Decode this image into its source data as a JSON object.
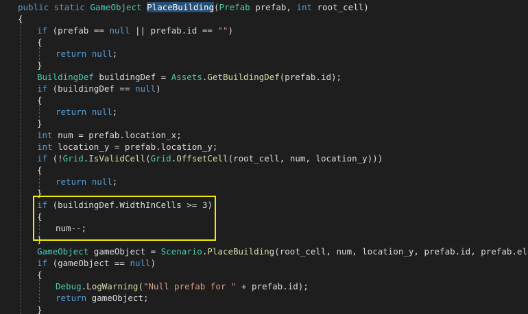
{
  "editor": {
    "theme_colors": {
      "background": "#1e1e1e",
      "keyword": "#569cd6",
      "type": "#4ec9b0",
      "method": "#dcdcaa",
      "string": "#d69d85",
      "plain": "#dcdcdc",
      "highlight_box": "#f2ea00"
    },
    "lines": [
      {
        "indent": 1,
        "tokens": [
          {
            "t": "public static ",
            "c": "kw"
          },
          {
            "t": "GameObject",
            "c": "ty"
          },
          {
            "t": " ",
            "c": "pl"
          },
          {
            "t": "PlaceBuilding",
            "c": "hl"
          },
          {
            "t": "(",
            "c": "pl"
          },
          {
            "t": "Prefab",
            "c": "ty"
          },
          {
            "t": " prefab, ",
            "c": "pl"
          },
          {
            "t": "int",
            "c": "kw"
          },
          {
            "t": " root_cell)",
            "c": "pl"
          }
        ]
      },
      {
        "indent": 1,
        "tokens": [
          {
            "t": "{",
            "c": "pl"
          }
        ]
      },
      {
        "indent": 2,
        "tokens": [
          {
            "t": "if",
            "c": "kw"
          },
          {
            "t": " (prefab == ",
            "c": "pl"
          },
          {
            "t": "null",
            "c": "kw"
          },
          {
            "t": " || prefab.id == ",
            "c": "pl"
          },
          {
            "t": "\"\"",
            "c": "st"
          },
          {
            "t": ")",
            "c": "pl"
          }
        ]
      },
      {
        "indent": 2,
        "tokens": [
          {
            "t": "{",
            "c": "pl"
          }
        ]
      },
      {
        "indent": 3,
        "tokens": [
          {
            "t": "return",
            "c": "kw"
          },
          {
            "t": " ",
            "c": "pl"
          },
          {
            "t": "null",
            "c": "kw"
          },
          {
            "t": ";",
            "c": "pl"
          }
        ]
      },
      {
        "indent": 2,
        "tokens": [
          {
            "t": "}",
            "c": "pl"
          }
        ]
      },
      {
        "indent": 2,
        "tokens": [
          {
            "t": "BuildingDef",
            "c": "ty"
          },
          {
            "t": " buildingDef = ",
            "c": "pl"
          },
          {
            "t": "Assets",
            "c": "ty"
          },
          {
            "t": ".",
            "c": "pl"
          },
          {
            "t": "GetBuildingDef",
            "c": "mt"
          },
          {
            "t": "(prefab.id);",
            "c": "pl"
          }
        ]
      },
      {
        "indent": 2,
        "tokens": [
          {
            "t": "if",
            "c": "kw"
          },
          {
            "t": " (buildingDef == ",
            "c": "pl"
          },
          {
            "t": "null",
            "c": "kw"
          },
          {
            "t": ")",
            "c": "pl"
          }
        ]
      },
      {
        "indent": 2,
        "tokens": [
          {
            "t": "{",
            "c": "pl"
          }
        ]
      },
      {
        "indent": 3,
        "tokens": [
          {
            "t": "return",
            "c": "kw"
          },
          {
            "t": " ",
            "c": "pl"
          },
          {
            "t": "null",
            "c": "kw"
          },
          {
            "t": ";",
            "c": "pl"
          }
        ]
      },
      {
        "indent": 2,
        "tokens": [
          {
            "t": "}",
            "c": "pl"
          }
        ]
      },
      {
        "indent": 2,
        "tokens": [
          {
            "t": "int",
            "c": "kw"
          },
          {
            "t": " num = prefab.location_x;",
            "c": "pl"
          }
        ]
      },
      {
        "indent": 2,
        "tokens": [
          {
            "t": "int",
            "c": "kw"
          },
          {
            "t": " location_y = prefab.location_y;",
            "c": "pl"
          }
        ]
      },
      {
        "indent": 2,
        "tokens": [
          {
            "t": "if",
            "c": "kw"
          },
          {
            "t": " (!",
            "c": "pl"
          },
          {
            "t": "Grid",
            "c": "ty"
          },
          {
            "t": ".",
            "c": "pl"
          },
          {
            "t": "IsValidCell",
            "c": "mt"
          },
          {
            "t": "(",
            "c": "pl"
          },
          {
            "t": "Grid",
            "c": "ty"
          },
          {
            "t": ".",
            "c": "pl"
          },
          {
            "t": "OffsetCell",
            "c": "mt"
          },
          {
            "t": "(root_cell, num, location_y)))",
            "c": "pl"
          }
        ]
      },
      {
        "indent": 2,
        "tokens": [
          {
            "t": "{",
            "c": "pl"
          }
        ]
      },
      {
        "indent": 3,
        "tokens": [
          {
            "t": "return",
            "c": "kw"
          },
          {
            "t": " ",
            "c": "pl"
          },
          {
            "t": "null",
            "c": "kw"
          },
          {
            "t": ";",
            "c": "pl"
          }
        ]
      },
      {
        "indent": 2,
        "tokens": [
          {
            "t": "}",
            "c": "pl"
          }
        ]
      },
      {
        "indent": 2,
        "tokens": [
          {
            "t": "if",
            "c": "kw"
          },
          {
            "t": " (buildingDef.WidthInCells >= 3)",
            "c": "pl"
          }
        ]
      },
      {
        "indent": 2,
        "tokens": [
          {
            "t": "{",
            "c": "pl"
          }
        ]
      },
      {
        "indent": 3,
        "tokens": [
          {
            "t": "num--;",
            "c": "pl"
          }
        ]
      },
      {
        "indent": 2,
        "tokens": [
          {
            "t": "}",
            "c": "pl"
          }
        ]
      },
      {
        "indent": 2,
        "tokens": [
          {
            "t": "GameObject",
            "c": "ty"
          },
          {
            "t": " gameObject = ",
            "c": "pl"
          },
          {
            "t": "Scenario",
            "c": "ty"
          },
          {
            "t": ".",
            "c": "pl"
          },
          {
            "t": "PlaceBuilding",
            "c": "mt"
          },
          {
            "t": "(root_cell, num, location_y, prefab.id, prefab.element);",
            "c": "pl"
          }
        ]
      },
      {
        "indent": 2,
        "tokens": [
          {
            "t": "if",
            "c": "kw"
          },
          {
            "t": " (gameObject == ",
            "c": "pl"
          },
          {
            "t": "null",
            "c": "kw"
          },
          {
            "t": ")",
            "c": "pl"
          }
        ]
      },
      {
        "indent": 2,
        "tokens": [
          {
            "t": "{",
            "c": "pl"
          }
        ]
      },
      {
        "indent": 3,
        "tokens": [
          {
            "t": "Debug",
            "c": "ty"
          },
          {
            "t": ".",
            "c": "pl"
          },
          {
            "t": "LogWarning",
            "c": "mt"
          },
          {
            "t": "(",
            "c": "pl"
          },
          {
            "t": "\"Null prefab for \"",
            "c": "st"
          },
          {
            "t": " + prefab.id);",
            "c": "pl"
          }
        ]
      },
      {
        "indent": 3,
        "tokens": [
          {
            "t": "return",
            "c": "kw"
          },
          {
            "t": " gameObject;",
            "c": "pl"
          }
        ]
      },
      {
        "indent": 2,
        "tokens": [
          {
            "t": "}",
            "c": "pl"
          }
        ]
      }
    ]
  }
}
